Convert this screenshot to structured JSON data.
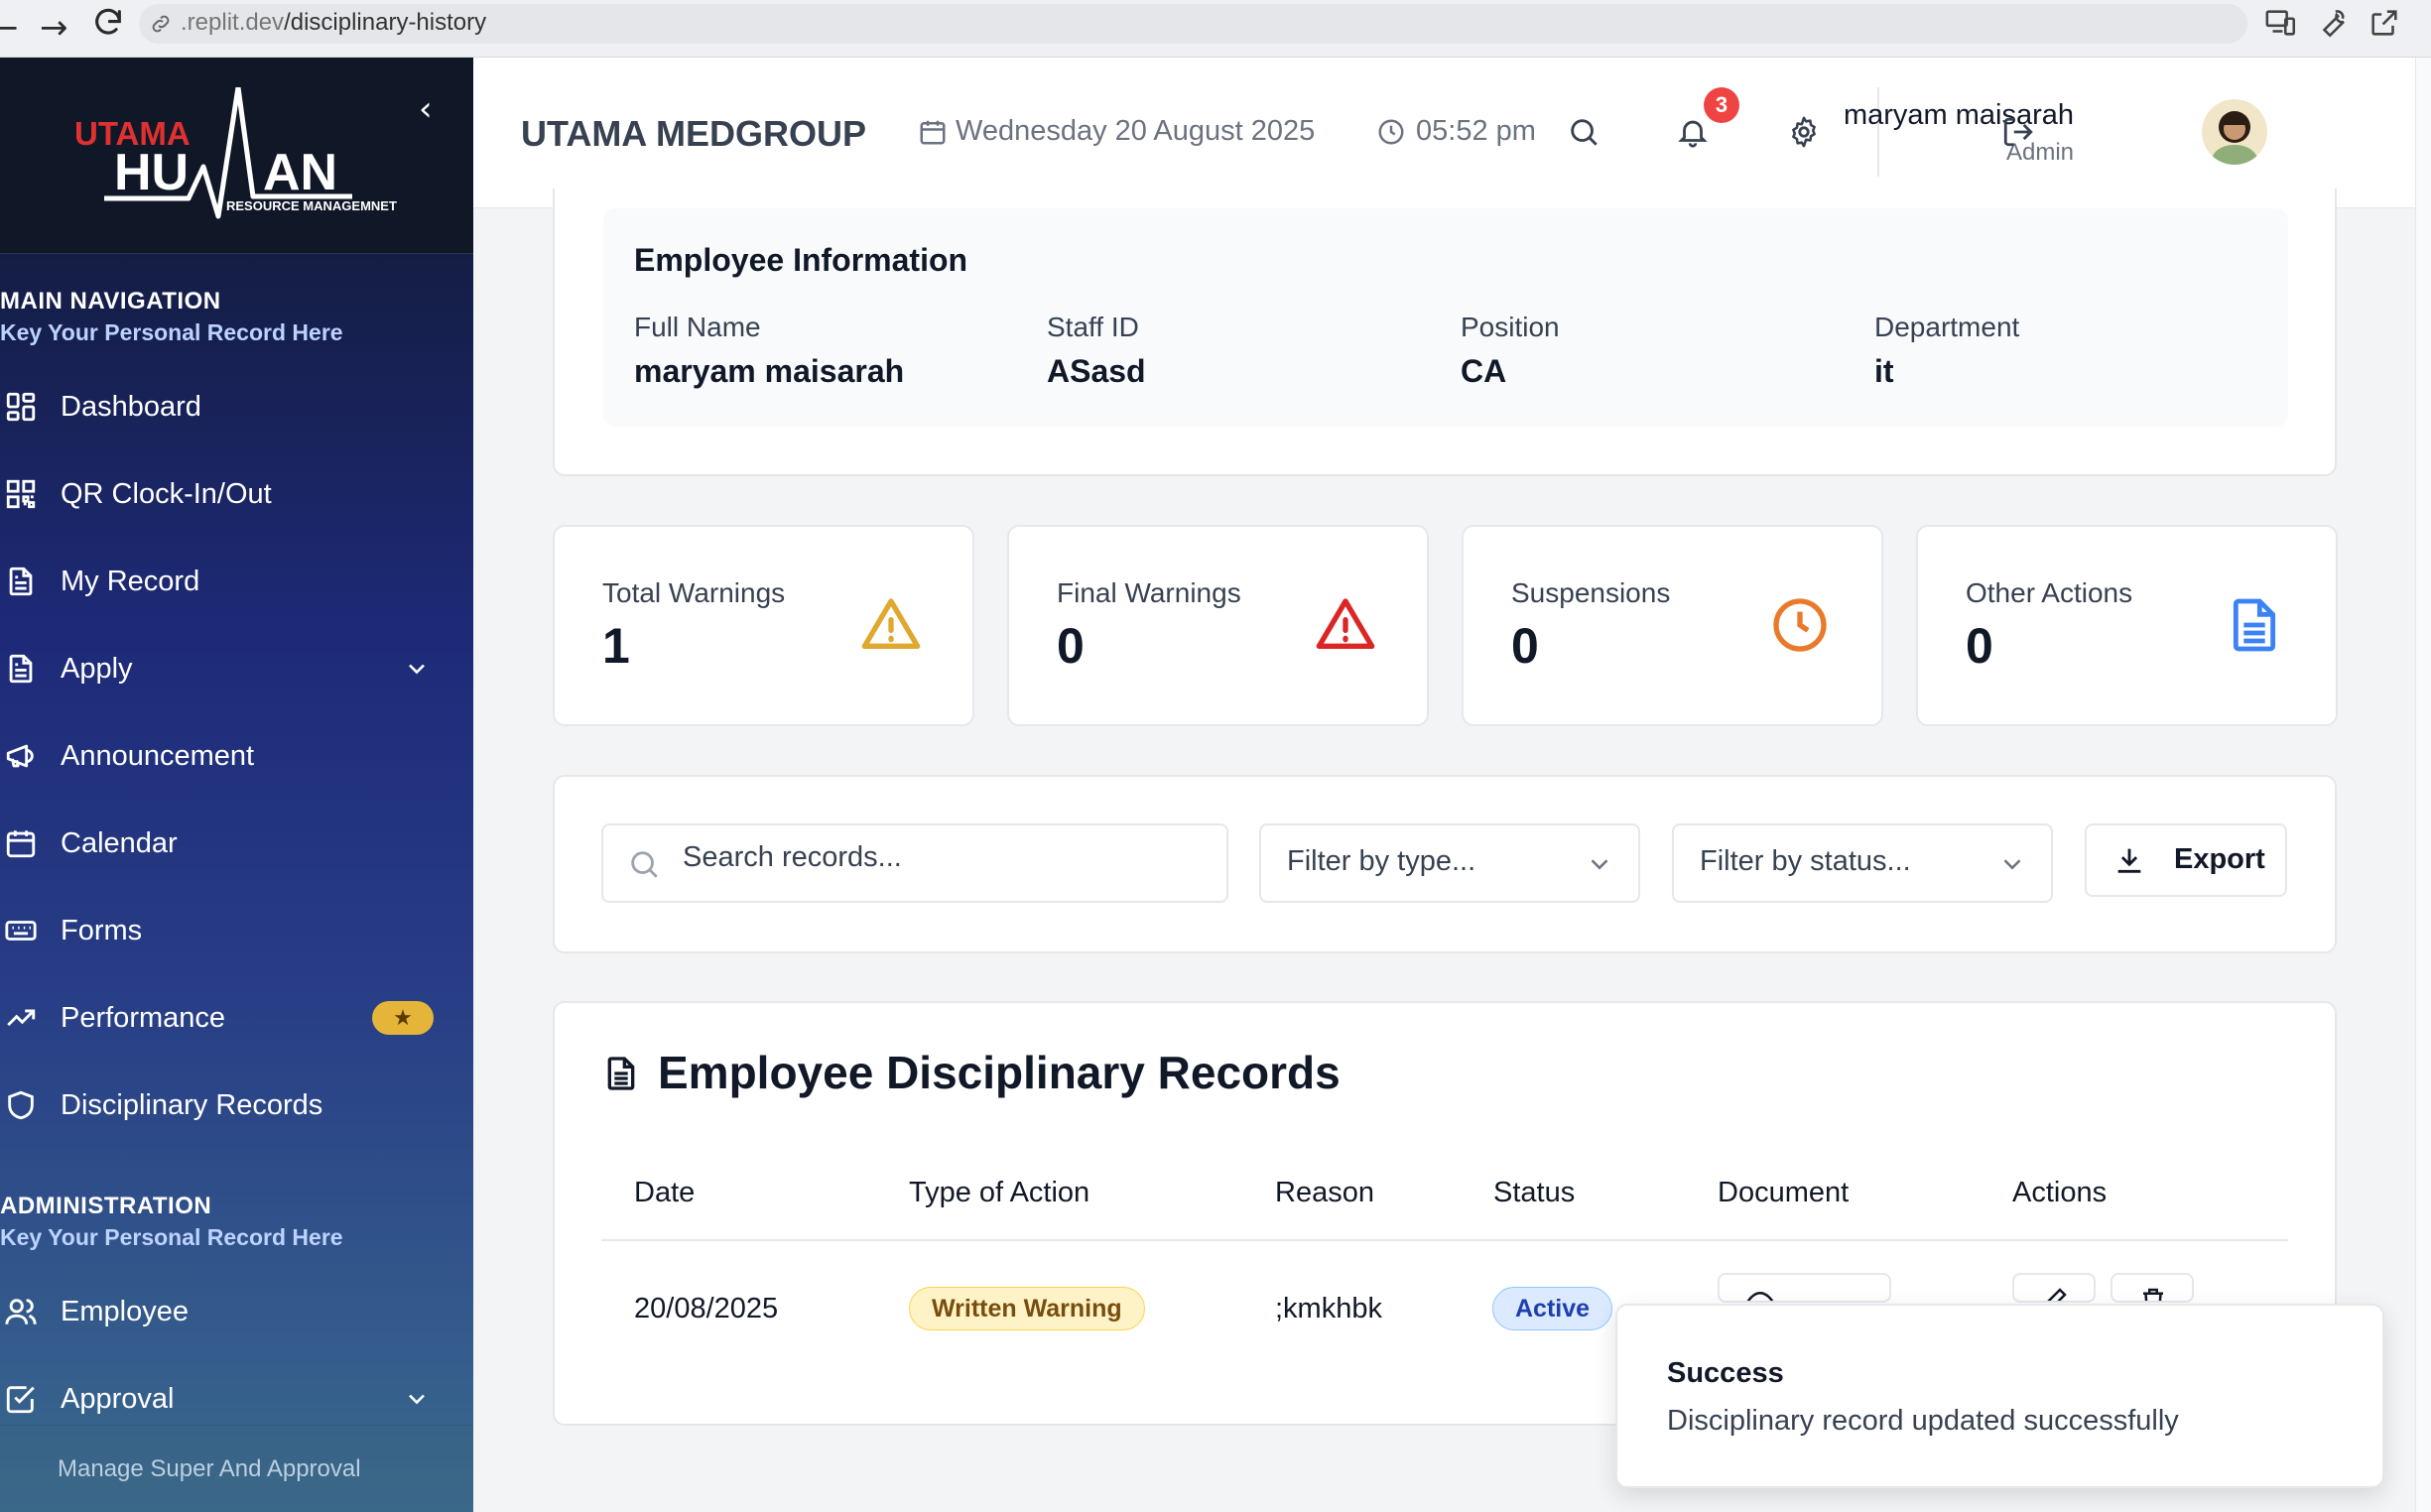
{
  "browser": {
    "url_host": ".replit.dev",
    "url_path": "/disciplinary-history",
    "back_icon": "arrow-left-icon",
    "forward_icon": "arrow-right-icon",
    "reload_icon": "reload-icon"
  },
  "sidebar": {
    "logo_top": "UTAMA",
    "logo_main": "HUMAN",
    "logo_sub": "RESOURCE MANAGEMNET",
    "main_nav_title": "MAIN NAVIGATION",
    "main_nav_sub": "Key Your Personal Record Here",
    "items": [
      {
        "label": "Dashboard",
        "icon": "dashboard-icon"
      },
      {
        "label": "QR Clock-In/Out",
        "icon": "qr-icon"
      },
      {
        "label": "My Record",
        "icon": "document-icon"
      },
      {
        "label": "Apply",
        "icon": "document-icon"
      },
      {
        "label": "Announcement",
        "icon": "megaphone-icon"
      },
      {
        "label": "Calendar",
        "icon": "calendar-icon"
      },
      {
        "label": "Forms",
        "icon": "keyboard-icon"
      },
      {
        "label": "Performance",
        "icon": "trending-up-icon",
        "badge": "★"
      },
      {
        "label": "Disciplinary Records",
        "icon": "shield-icon"
      }
    ],
    "admin_title": "ADMINISTRATION",
    "admin_sub": "Key Your Personal Record Here",
    "admin_items": [
      {
        "label": "Employee",
        "icon": "users-icon"
      },
      {
        "label": "Approval",
        "icon": "checkbox-icon"
      }
    ],
    "footer": "Manage Super And Approval"
  },
  "header": {
    "company": "UTAMA MEDGROUP",
    "date": "Wednesday 20 August 2025",
    "time": "05:52 pm",
    "notification_count": "3",
    "user_name": "maryam maisarah",
    "user_role": "Admin"
  },
  "employee_info": {
    "title": "Employee Information",
    "fields": [
      {
        "label": "Full Name",
        "value": "maryam maisarah"
      },
      {
        "label": "Staff ID",
        "value": "ASasd"
      },
      {
        "label": "Position",
        "value": "CA"
      },
      {
        "label": "Department",
        "value": "it"
      }
    ]
  },
  "stats": [
    {
      "label": "Total Warnings",
      "value": "1",
      "icon": "warning-triangle-icon",
      "color": "#e0a82e"
    },
    {
      "label": "Final Warnings",
      "value": "0",
      "icon": "alert-triangle-icon",
      "color": "#dc2626"
    },
    {
      "label": "Suspensions",
      "value": "0",
      "icon": "clock-icon",
      "color": "#ea7a2b"
    },
    {
      "label": "Other Actions",
      "value": "0",
      "icon": "file-text-icon",
      "color": "#3b82f6"
    }
  ],
  "filters": {
    "search_placeholder": "Search records...",
    "type_placeholder": "Filter by type...",
    "status_placeholder": "Filter by status...",
    "export_label": "Export"
  },
  "records": {
    "title": "Employee Disciplinary Records",
    "columns": [
      "Date",
      "Type of Action",
      "Reason",
      "Status",
      "Document",
      "Actions"
    ],
    "rows": [
      {
        "date": "20/08/2025",
        "type": "Written Warning",
        "reason": ";kmkhbk",
        "status": "Active"
      }
    ]
  },
  "toast": {
    "title": "Success",
    "message": "Disciplinary record updated successfully"
  }
}
